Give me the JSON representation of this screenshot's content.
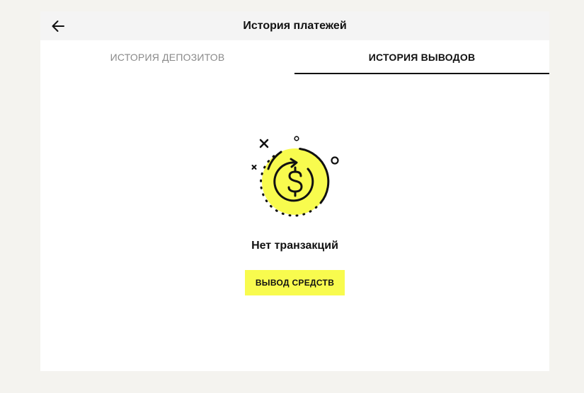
{
  "header": {
    "title": "История платежей",
    "back_icon": "arrow-left-icon"
  },
  "tabs": [
    {
      "label": "ИСТОРИЯ ДЕПОЗИТОВ",
      "active": false
    },
    {
      "label": "ИСТОРИЯ ВЫВОДОВ",
      "active": true
    }
  ],
  "empty_state": {
    "icon": "coin-refresh-icon",
    "title": "Нет транзакций",
    "button_label": "ВЫВОД СРЕДСТВ"
  },
  "colors": {
    "accent_yellow": "#f8fb4e",
    "text": "#111111",
    "muted_text": "#8a8a8a",
    "page_bg": "#f4f3ef",
    "header_bg": "#f4f4f4",
    "panel_bg": "#ffffff"
  }
}
